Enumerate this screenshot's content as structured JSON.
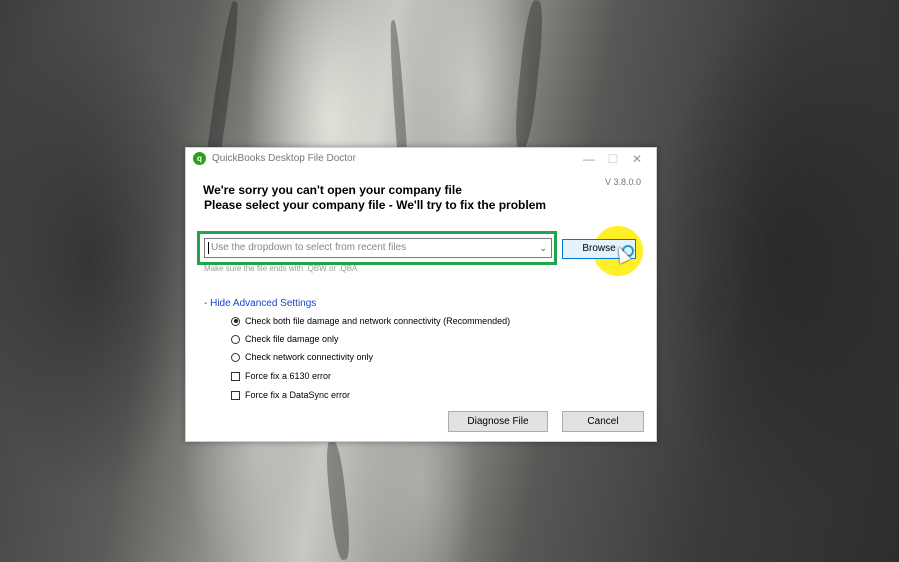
{
  "window": {
    "title": "QuickBooks Desktop File Doctor",
    "app_icon_glyph": "q",
    "minimize_glyph": "—",
    "maximize_glyph": "☐",
    "close_glyph": "✕",
    "version": "V 3.8.0.0"
  },
  "headline": {
    "line1": "We're sorry you can't open your company file",
    "line2": "Please select your company file - We'll try to fix the problem"
  },
  "file_select": {
    "placeholder": "Use the dropdown to select from recent files",
    "chevron": "⌄"
  },
  "hint": "Make sure the file ends with .QBW or .QBA",
  "browse_label": "Browse",
  "advanced_toggle": "- Hide Advanced Settings",
  "options": [
    {
      "type": "radio",
      "label": "Check both file damage and network connectivity (Recommended)",
      "checked": true
    },
    {
      "type": "radio",
      "label": "Check file damage only",
      "checked": false
    },
    {
      "type": "radio",
      "label": "Check network connectivity only",
      "checked": false
    },
    {
      "type": "checkbox",
      "label": "Force fix a 6130 error",
      "checked": false
    },
    {
      "type": "checkbox",
      "label": "Force fix a DataSync error",
      "checked": false
    }
  ],
  "buttons": {
    "diagnose": "Diagnose File",
    "cancel": "Cancel"
  },
  "colors": {
    "highlight": "#1fa64a",
    "brand": "#2ca01c",
    "link": "#1a44c7",
    "cursor_halo": "#ffec00"
  },
  "icons": [
    "quickbooks-logo-icon",
    "minimize-icon",
    "maximize-icon",
    "close-icon",
    "chevron-down-icon",
    "mouse-cursor-icon"
  ]
}
